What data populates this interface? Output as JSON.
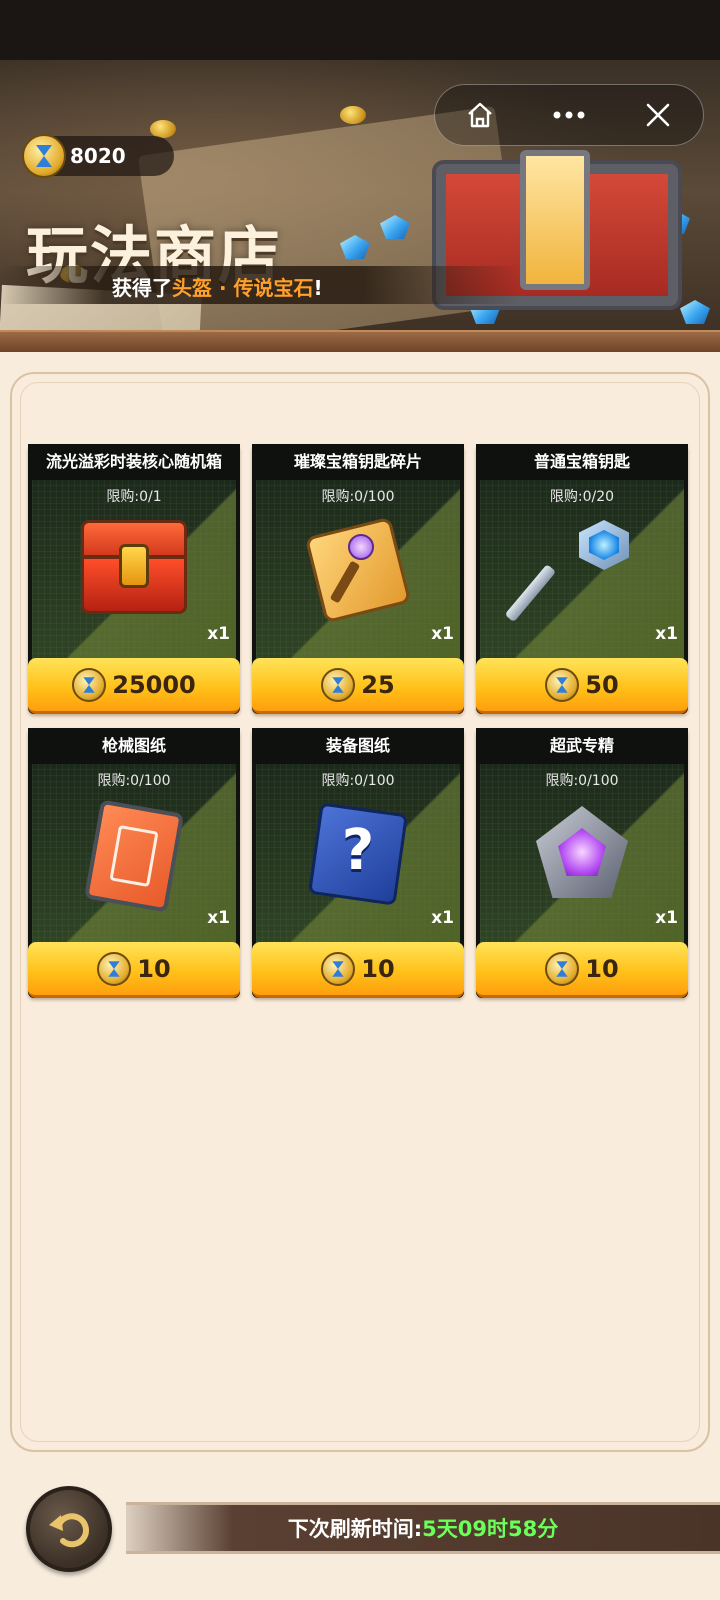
{
  "header": {
    "coin_balance": "8020",
    "title": "玩法商店",
    "marquee": {
      "prefix": "获得了",
      "highlight": "头盔 · 传说宝石",
      "suffix": "!"
    }
  },
  "top_buttons": [
    {
      "icon": "home-icon"
    },
    {
      "icon": "more-icon"
    },
    {
      "icon": "close-icon"
    }
  ],
  "shop": {
    "items": [
      {
        "name": "流光溢彩时装核心随机箱",
        "limit": "限购:0/1",
        "qty": "x1",
        "price": "25000",
        "icon": "chest-icon"
      },
      {
        "name": "璀璨宝箱钥匙碎片",
        "limit": "限购:0/100",
        "qty": "x1",
        "price": "25",
        "icon": "key-fragment-icon"
      },
      {
        "name": "普通宝箱钥匙",
        "limit": "限购:0/20",
        "qty": "x1",
        "price": "50",
        "icon": "key-icon"
      },
      {
        "name": "枪械图纸",
        "limit": "限购:0/100",
        "qty": "x1",
        "price": "10",
        "icon": "gun-blueprint-icon"
      },
      {
        "name": "装备图纸",
        "limit": "限购:0/100",
        "qty": "x1",
        "price": "10",
        "icon": "gear-blueprint-icon"
      },
      {
        "name": "超武专精",
        "limit": "限购:0/100",
        "qty": "x1",
        "price": "10",
        "icon": "super-weapon-icon"
      }
    ]
  },
  "footer": {
    "refresh_label": "下次刷新时间:",
    "refresh_time": "5天09时58分"
  },
  "colors": {
    "accent_gold": "#ffc21a",
    "timer_green": "#6bff5a",
    "panel_bg": "#f9ecdc"
  }
}
